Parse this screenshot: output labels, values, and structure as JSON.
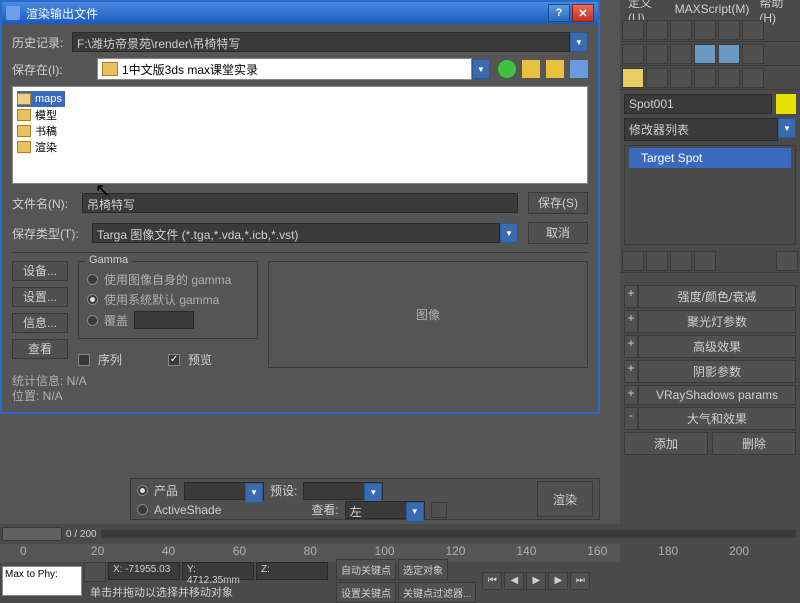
{
  "dialog": {
    "title": "渲染输出文件",
    "history_label": "历史记录:",
    "history_value": "F:\\潍坊帝景苑\\render\\吊椅特写",
    "savein_label": "保存在(I):",
    "savein_value": "1中文版3ds max课堂实录",
    "folders": [
      "maps",
      "模型",
      "书稿",
      "渲染"
    ],
    "filename_label": "文件名(N):",
    "filename_value": "吊椅特写",
    "filetype_label": "保存类型(T):",
    "filetype_value": "Targa 图像文件 (*.tga,*.vda,*.icb,*.vst)",
    "save_btn": "保存(S)",
    "cancel_btn": "取消",
    "device_btn": "设备...",
    "setup_btn": "设置...",
    "info_btn": "信息...",
    "view_btn": "查看",
    "gamma": {
      "title": "Gamma",
      "opt1": "使用图像自身的 gamma",
      "opt2": "使用系统默认 gamma",
      "opt3": "覆盖"
    },
    "image_label": "图像",
    "sequence": "序列",
    "preview": "预览",
    "stats1": "统计信息: N/A",
    "stats2": "位置: N/A"
  },
  "menu": {
    "custom": "定义(U)",
    "maxscript": "MAXScript(M)",
    "help": "帮助(H)"
  },
  "right": {
    "obj_name": "Spot001",
    "modifier_list": "修改器列表",
    "target_spot": "Target Spot",
    "rollouts": [
      "强度/颜色/衰减",
      "聚光灯参数",
      "高级效果",
      "阴影参数",
      "VRayShadows params",
      "大气和效果"
    ],
    "add": "添加",
    "delete": "删除"
  },
  "render_strip": {
    "product": "产品",
    "activeshade": "ActiveShade",
    "preset": "预设:",
    "view": "查看:",
    "view_val": "左",
    "render_btn": "渲染"
  },
  "timeline": {
    "range": "0 / 200",
    "ticks": [
      "0",
      "20",
      "40",
      "60",
      "80",
      "100",
      "120",
      "140",
      "160",
      "180",
      "200"
    ]
  },
  "bottom": {
    "script": "Max to Phy:",
    "x": "X: -71955.03",
    "y": "Y: 4712.35mm",
    "z": "Z:",
    "status": "单击并拖动以选择并移动对象",
    "autokey": "自动关键点",
    "selected": "选定对象",
    "setkey": "设置关键点",
    "keyfilter": "关键点过滤器..."
  }
}
